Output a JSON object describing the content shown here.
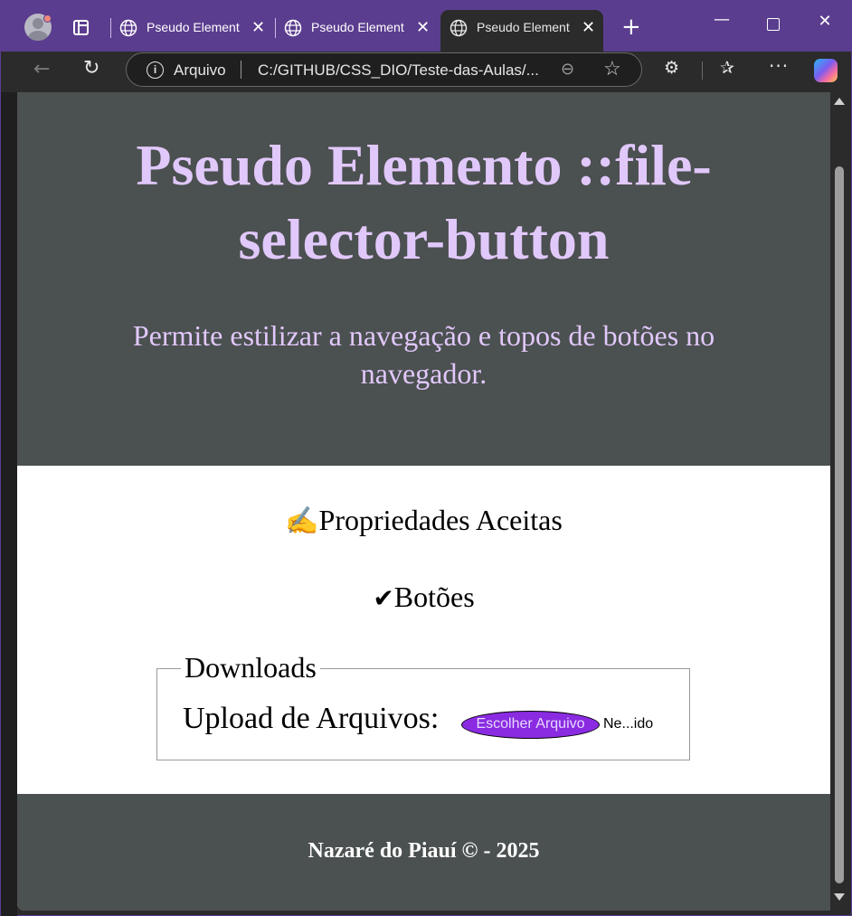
{
  "browser": {
    "tabs": [
      {
        "title": "Pseudo Element",
        "active": false
      },
      {
        "title": "Pseudo Element",
        "active": false
      },
      {
        "title": "Pseudo Element",
        "active": true
      }
    ],
    "close_glyph": "✕",
    "new_tab_glyph": "+",
    "address": {
      "scheme_label": "Arquivo",
      "url": "C:/GITHUB/CSS_DIO/Teste-das-Aulas/..."
    },
    "theme_color": "#5b3d8f"
  },
  "page": {
    "title": "Pseudo Elemento ::file-selector-button",
    "subtitle": "Permite estilizar a navegação e topos de botões no navegador.",
    "properties_emoji": "✍️",
    "properties_heading": "Propriedades Aceitas",
    "check_glyph": "✔",
    "buttons_item": "Botões",
    "fieldset_legend": "Downloads",
    "upload_label": "Upload de Arquivos:",
    "file_button_label": "Escolher Arquivo",
    "file_status": "Ne...ido",
    "footer": "Nazaré do Piauí © - 2025",
    "colors": {
      "header_bg": "#4b5050",
      "heading_text": "#e1c8fb",
      "file_button_bg": "#8a2be2"
    }
  }
}
